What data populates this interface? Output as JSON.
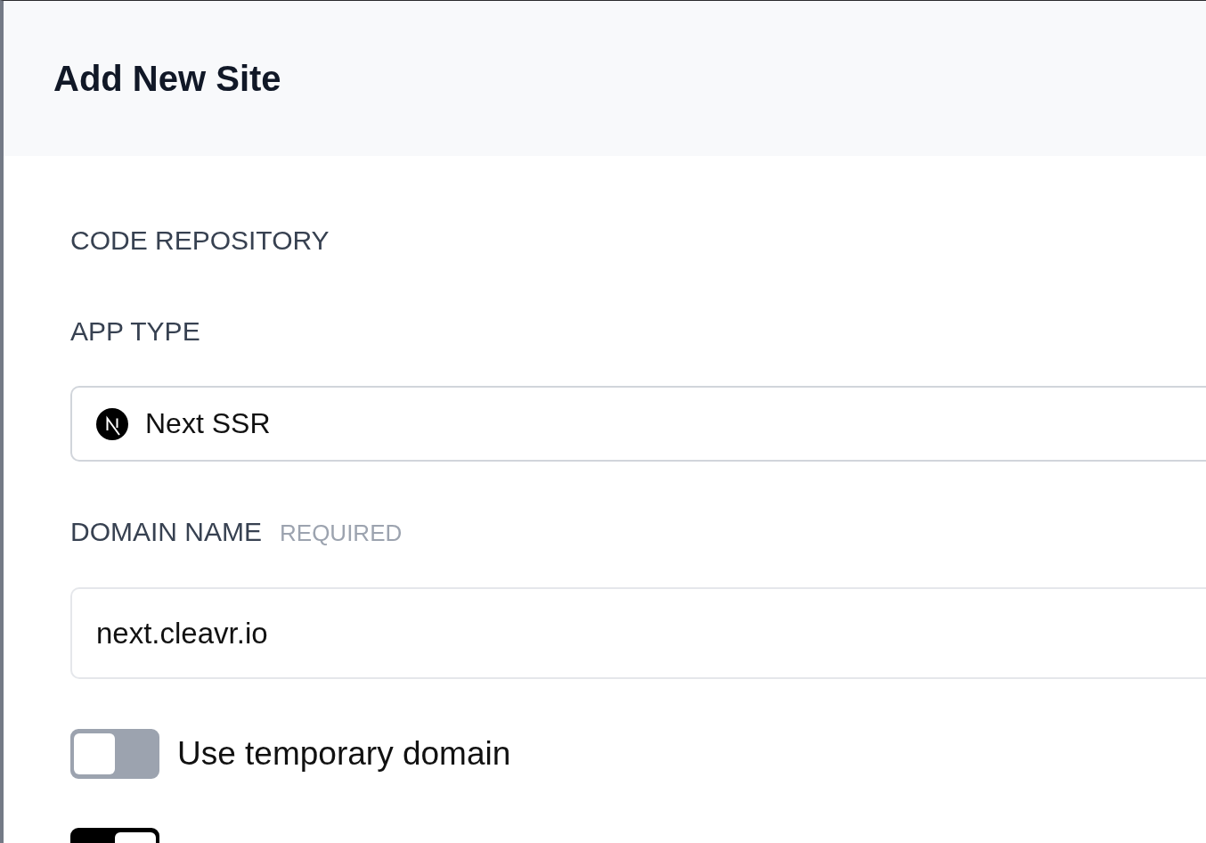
{
  "header": {
    "title": "Add New Site"
  },
  "sections": [
    {
      "kind": "heading",
      "label": "CODE REPOSITORY"
    },
    {
      "kind": "select",
      "label": "APP TYPE",
      "value": "Next SSR"
    },
    {
      "kind": "input",
      "label": "DOMAIN NAME",
      "hint": "REQUIRED",
      "value": "next.cleavr.io"
    }
  ],
  "toggles": [
    {
      "label": "Use temporary domain",
      "checked": false
    },
    {
      "checked": true
    }
  ]
}
